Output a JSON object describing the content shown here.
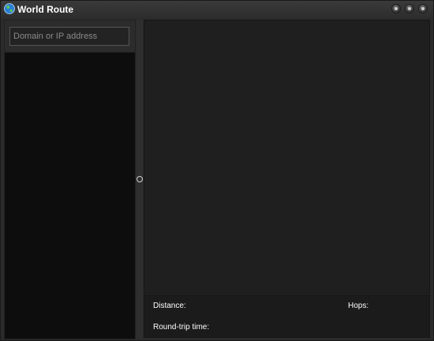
{
  "window": {
    "title": "World Route",
    "controls": {
      "minimize": "minimize-button",
      "maximize": "maximize-button",
      "close": "close-button"
    },
    "app_icon": "globe-icon"
  },
  "sidebar": {
    "search": {
      "placeholder": "Domain or IP address",
      "value": ""
    },
    "route_items": []
  },
  "info": {
    "distance_label": "Distance:",
    "distance_value": "",
    "hops_label": "Hops:",
    "hops_value": "",
    "rtt_label": "Round-trip time:",
    "rtt_value": ""
  },
  "colors": {
    "background": "#2b2b2b",
    "list_background": "#0d0d0d",
    "map_background": "#1f1f1f",
    "text": "#ffffff"
  }
}
